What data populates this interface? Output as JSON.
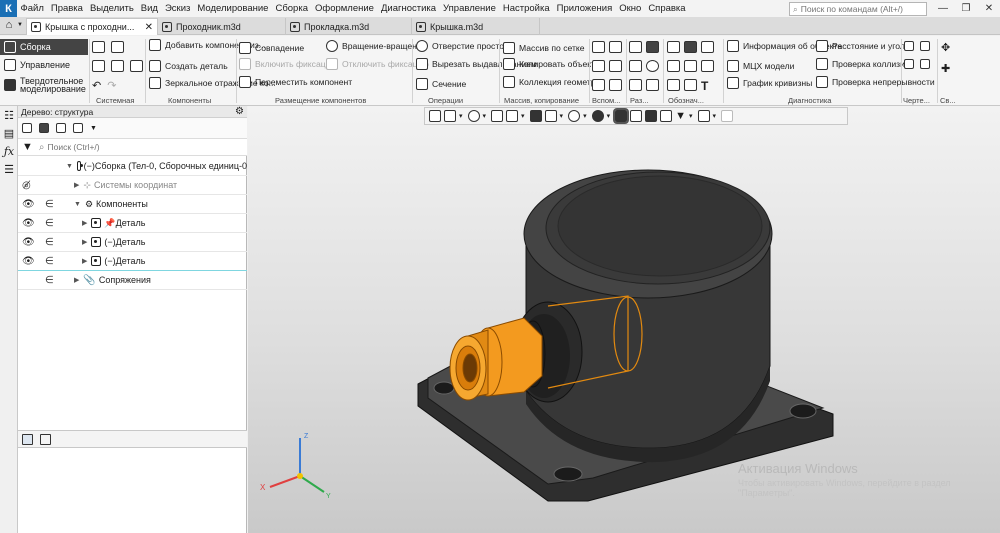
{
  "app": {
    "logo": "К"
  },
  "menu": [
    "Файл",
    "Правка",
    "Выделить",
    "Вид",
    "Эскиз",
    "Моделирование",
    "Сборка",
    "Оформление",
    "Диагностика",
    "Управление",
    "Настройка",
    "Приложения",
    "Окно",
    "Справка"
  ],
  "command_search": {
    "placeholder": "Поиск по командам (Alt+/)"
  },
  "window_controls": {
    "minimize": "—",
    "restore": "❐",
    "close": "✕"
  },
  "tabs": [
    {
      "label": "Крышка с проходни...",
      "close": "✕",
      "active": true
    },
    {
      "label": "Проходник.m3d",
      "active": false
    },
    {
      "label": "Прокладка.m3d",
      "active": false
    },
    {
      "label": "Крышка.m3d",
      "active": false
    }
  ],
  "ribbon": {
    "modes": [
      "Сборка",
      "Управление",
      "Твердотельное моделирование"
    ],
    "system": {
      "label": "Системная"
    },
    "components": {
      "add": "Добавить компонент из...",
      "create": "Создать деталь",
      "mirror": "Зеркальное отражение ко...",
      "label": "Компоненты"
    },
    "placement": {
      "coincide": "Совпадение",
      "fix_on": "Включить фиксацию",
      "move": "Переместить компонент",
      "rotate": "Вращение-вращение",
      "fix_off": "Отключить фиксацию",
      "label": "Размещение компонентов"
    },
    "operations": {
      "hole": "Отверстие простое",
      "cut": "Вырезать выдавливанием",
      "section": "Сечение",
      "label": "Операции"
    },
    "arrays": {
      "grid": "Массив по сетке",
      "copy": "Копировать объекты",
      "collection": "Коллекция геометрии",
      "label": "Массив, копирование"
    },
    "aux_label": "Вспом...",
    "raz_label": "Раз...",
    "oboz_label": "Обознач...",
    "diagnostics": {
      "info": "Информация об объекте",
      "mcx": "МЦХ модели",
      "curvature": "График кривизны",
      "distance": "Расстояние и угол",
      "collisions": "Проверка коллизий",
      "continuity": "Проверка непрерывности",
      "label": "Диагностика"
    },
    "drawing_label": "Черте...",
    "last_label": "Св..."
  },
  "tree": {
    "header": "Дерево: структура",
    "filter_placeholder": "Поиск (Ctrl+/)",
    "rows": [
      {
        "text": "(−)Сборка (Тел-0, Сборочных единиц-0"
      },
      {
        "text": "Системы координат"
      },
      {
        "text": "Компоненты"
      },
      {
        "text": "Деталь"
      },
      {
        "text": "(−)Деталь"
      },
      {
        "text": "(−)Деталь"
      },
      {
        "text": "Сопряжения"
      }
    ]
  },
  "triad": {
    "x": "X",
    "y": "Y",
    "z": "Z"
  },
  "watermark": {
    "title": "Активация Windows",
    "subtitle": "Чтобы активировать Windows, перейдите в раздел \"Параметры\"."
  },
  "colors": {
    "selected": "#f39a1f",
    "body": "#3a3a3a",
    "accent": "#1a6fb5"
  }
}
